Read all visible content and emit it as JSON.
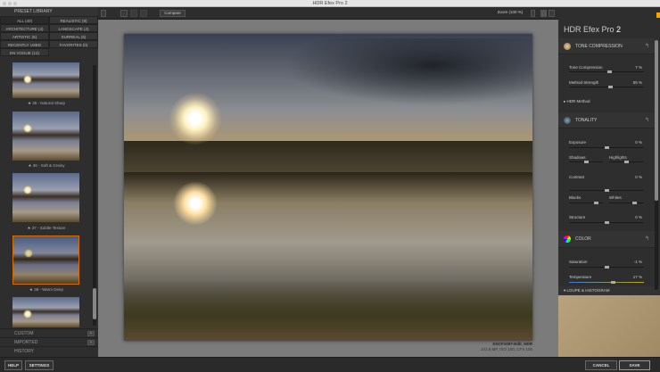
{
  "window": {
    "title": "HDR Efex Pro 2"
  },
  "library": {
    "title": "PRESET LIBRARY",
    "categories": [
      "ALL (40)",
      "REALISTIC (9)",
      "ARCHITECTURE (4)",
      "LANDSCAPE (4)",
      "ARTISTIC (6)",
      "SURREAL (5)",
      "RECENTLY USED",
      "FAVORITES (0)",
      "EN VOGUE (12)"
    ],
    "selected": "ALL (40)",
    "presets": [
      "★ 35 - Natural Sharp",
      "★ 36 - Soft & Grainy",
      "★ 37 - Subtle Texture",
      "★ 38 - Warm Deep"
    ],
    "selected_preset": "★ 38 - Warm Deep",
    "sections": [
      "CUSTOM",
      "IMPORTED",
      "HISTORY"
    ]
  },
  "toolbar": {
    "compare": "Compare",
    "zoom": "Zoom (100 %)"
  },
  "image": {
    "filename": "DSCF1097-Edit_HDR",
    "info": "101.8 MP, ISO 100, CFX 100"
  },
  "panel": {
    "brand": "HDR Efex Pro",
    "version": "2",
    "accent": "#f5a800",
    "tone": {
      "title": "TONE COMPRESSION",
      "tone_compression": {
        "label": "Tone Compression",
        "value": "7 %"
      },
      "method_strength": {
        "label": "Method Strength",
        "value": "55 %"
      },
      "hdr_method": "HDR Method"
    },
    "tonality": {
      "title": "TONALITY",
      "exposure": {
        "label": "Exposure",
        "value": "0 %"
      },
      "shadows": "Shadows",
      "highlights": "Highlights",
      "contrast": {
        "label": "Contrast",
        "value": "0 %"
      },
      "blacks": "Blacks",
      "whites": "Whites",
      "structure": {
        "label": "Structure",
        "value": "0 %"
      }
    },
    "color": {
      "title": "COLOR",
      "saturation": {
        "label": "Saturation",
        "value": "-1 %"
      },
      "temperature": {
        "label": "Temperature",
        "value": "17 %"
      }
    },
    "loupe": "LOUPE & HISTOGRAM"
  },
  "footer": {
    "help": "HELP",
    "settings": "SETTINGS",
    "cancel": "CANCEL",
    "save": "SAVE"
  }
}
